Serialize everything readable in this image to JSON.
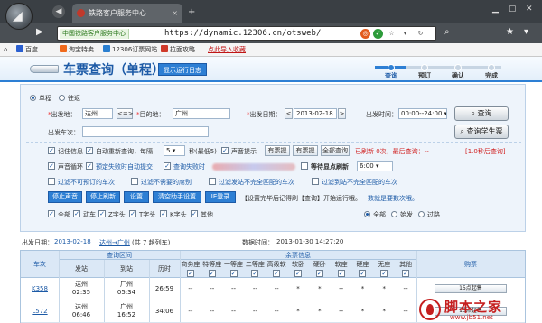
{
  "browser": {
    "tab_title": "铁路客户服务中心",
    "tab_close": "×",
    "new_tab": "+",
    "site_label": "中国铁路客户服务中心",
    "url": "https://dynamic.12306.cn/otsweb/",
    "bookmarks": [
      "百度",
      "淘宝特卖",
      "12306订票网站",
      "拉面攻略",
      "点此导入收藏"
    ]
  },
  "header": {
    "title": "车票查询（单程）",
    "schedule_button": "显示运行日志",
    "steps": [
      "查询",
      "预订",
      "确认",
      "完成"
    ],
    "progress_fraction": 0.25
  },
  "query": {
    "trip_one_way": "单程",
    "trip_round": "往返",
    "from_label": "出发地：",
    "from_value": "达州",
    "swap_label": "<=>",
    "to_label": "目的地：",
    "to_value": "广州",
    "date_label": "出发日期：",
    "date_value": "2013-02-18",
    "prev_day": "<",
    "next_day": ">",
    "time_label": "出发时间：",
    "time_value": "00:00--24:00",
    "query_button": "查询",
    "student_button": "查询学生票",
    "train_label": "出发车次：",
    "remember_label": "记住信息",
    "auto_refresh_label": "自动重新查询，每隔",
    "interval_value": "5",
    "interval_unit": "秒(最低5)",
    "sound_label": "声音提示",
    "tag_a": "有票提",
    "tag_b": "有票提",
    "full_query": "全部查询",
    "refresh_stats": "已刷新 0次，最后查询：--",
    "refresh_extra": "[1.0秒后查询]",
    "sound_loop": "声音循环",
    "auto_submit": "预定失败时自动提交",
    "query_fail": "查询失败时",
    "wait_label": "等待显点刷新",
    "wait_value": "6:00",
    "filters": [
      "过滤不可预订的车次",
      "过滤不需要的席别",
      "过滤发站不完全匹配的车次",
      "过滤到站不完全匹配的车次"
    ],
    "actions": [
      "停止声音",
      "停止刷新",
      "设置",
      "清空助手设置",
      "IE登录"
    ],
    "notice": "【设置完毕后记得刷【查询】开始运行哦。",
    "notice_link": "数就是要数次哦。",
    "types": [
      "全部",
      "动车",
      "Z字头",
      "T字头",
      "K字头",
      "其他"
    ],
    "station_filter": [
      "全部",
      "始发",
      "过路"
    ]
  },
  "results": {
    "info_date_label": "出发日期：",
    "info_date": "2013-02-18",
    "info_route": "达州→广州",
    "info_count": "(共 7 趟列车)",
    "data_time_label": "数据时间：",
    "data_time": "2013-01-30 14:27:20",
    "group_route": "查询区间",
    "group_seats": "余票信息",
    "col_train": "车次",
    "col_from": "发站",
    "col_to": "到站",
    "col_duration": "历时",
    "seat_cols": [
      "商务座",
      "特等座",
      "一等座",
      "二等座",
      "高级软卧",
      "软卧",
      "硬卧",
      "软座",
      "硬座",
      "无座",
      "其他"
    ],
    "col_book": "购票",
    "rows": [
      {
        "train": "K358",
        "from": "达州",
        "from_time": "02:35",
        "to": "广州",
        "to_time": "05:34",
        "duration": "26:59",
        "seats": [
          "--",
          "--",
          "--",
          "--",
          "--",
          "*",
          "*",
          "--",
          "*",
          "*",
          "--"
        ],
        "book": "15点起售"
      },
      {
        "train": "L572",
        "from": "达州",
        "from_time": "06:46",
        "to": "广州",
        "to_time": "16:52",
        "duration": "34:06",
        "seats": [
          "--",
          "--",
          "--",
          "--",
          "--",
          "*",
          "*",
          "--",
          "*",
          "*",
          "--"
        ],
        "book": "15点起售"
      }
    ]
  },
  "watermark": {
    "title": "脚本之家",
    "url": "www.jb51.net"
  }
}
